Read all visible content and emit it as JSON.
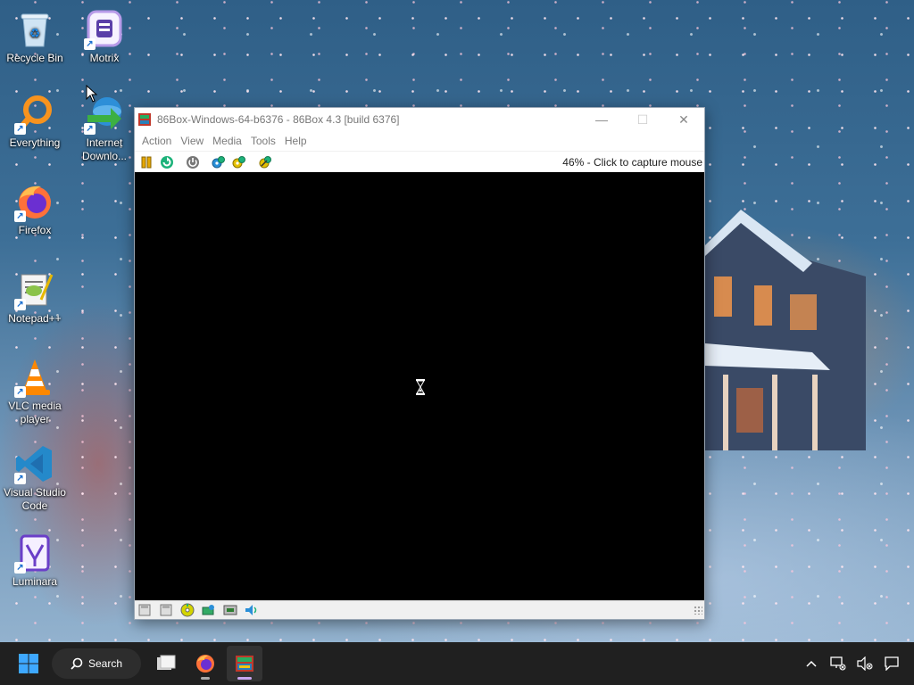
{
  "desktop": {
    "icons": [
      {
        "label": "Recycle Bin"
      },
      {
        "label": "Motrix"
      },
      {
        "label": "Everything"
      },
      {
        "label": "Internet Downlo..."
      },
      {
        "label": "Firefox"
      },
      {
        "label": "Notepad++"
      },
      {
        "label": "VLC media player"
      },
      {
        "label": "Visual Studio Code"
      },
      {
        "label": "Luminara"
      }
    ]
  },
  "window": {
    "title": "86Box-Windows-64-b6376 - 86Box 4.3 [build 6376]",
    "buttons": {
      "minimize": "—",
      "maximize": "☐",
      "close": "✕"
    },
    "menu": [
      "Action",
      "View",
      "Media",
      "Tools",
      "Help"
    ],
    "toolbar": {
      "items": [
        "pause-icon",
        "reset-icon",
        "power-icon",
        "settings-icon",
        "hard-reset-icon",
        "ctrl-alt-del-icon"
      ],
      "status": "46% - Click to capture mouse"
    },
    "statusbar_items": [
      "floppy-1-icon",
      "floppy-2-icon",
      "cdrom-icon",
      "hard-disk-icon",
      "network-icon",
      "sound-icon"
    ]
  },
  "taskbar": {
    "search_label": "Search",
    "apps": [
      "file-explorer-icon",
      "firefox-icon",
      "86box-icon"
    ]
  },
  "colors": {
    "taskbar": "#202020",
    "window_bg": "#f3f3f3",
    "screen": "#000000",
    "active_indicator": "#c7a6f0"
  }
}
